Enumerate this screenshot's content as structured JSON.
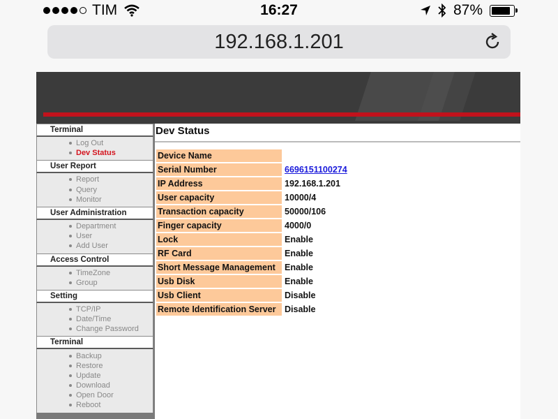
{
  "status_bar": {
    "carrier": "TIM",
    "time": "16:27",
    "battery": "87%",
    "battery_level": 0.87
  },
  "address_bar": {
    "url": "192.168.1.201"
  },
  "sidebar": {
    "groups": [
      {
        "header": "Terminal",
        "items": [
          "Log Out",
          "Dev Status"
        ]
      },
      {
        "header": "User Report",
        "items": [
          "Report",
          "Query",
          "Monitor"
        ]
      },
      {
        "header": "User Administration",
        "items": [
          "Department",
          "User",
          "Add User"
        ]
      },
      {
        "header": "Access Control",
        "items": [
          "TimeZone",
          "Group"
        ]
      },
      {
        "header": "Setting",
        "items": [
          "TCP/IP",
          "Date/Time",
          "Change Password"
        ]
      },
      {
        "header": "Terminal",
        "items": [
          "Backup",
          "Restore",
          "Update",
          "Download",
          "Open Door",
          "Reboot"
        ]
      }
    ],
    "active_item": "Dev Status"
  },
  "content": {
    "title": "Dev Status",
    "rows": [
      {
        "label": "Device Name",
        "value": ""
      },
      {
        "label": "Serial Number",
        "value": "6696151100274",
        "link": true
      },
      {
        "label": "IP Address",
        "value": "192.168.1.201"
      },
      {
        "label": "User capacity",
        "value": "10000/4"
      },
      {
        "label": "Transaction capacity",
        "value": "50000/106"
      },
      {
        "label": "Finger capacity",
        "value": "4000/0"
      },
      {
        "label": "Lock",
        "value": "Enable"
      },
      {
        "label": "RF Card",
        "value": "Enable"
      },
      {
        "label": "Short Message Management",
        "value": "Enable"
      },
      {
        "label": "Usb Disk",
        "value": "Enable"
      },
      {
        "label": "Usb Client",
        "value": "Disable"
      },
      {
        "label": "Remote Identification Server",
        "value": "Disable"
      }
    ]
  },
  "icons": {
    "signal": "signal-dots-icon",
    "wifi": "wifi-icon",
    "location": "location-arrow-icon",
    "bluetooth": "bluetooth-icon",
    "battery": "battery-icon",
    "reload": "reload-icon"
  },
  "colors": {
    "banner": "#3b3b3b",
    "banner_stripe": "#c1121c",
    "label_bg": "#fdc99a",
    "active_nav": "#d4151f",
    "link": "#1a1adb"
  }
}
